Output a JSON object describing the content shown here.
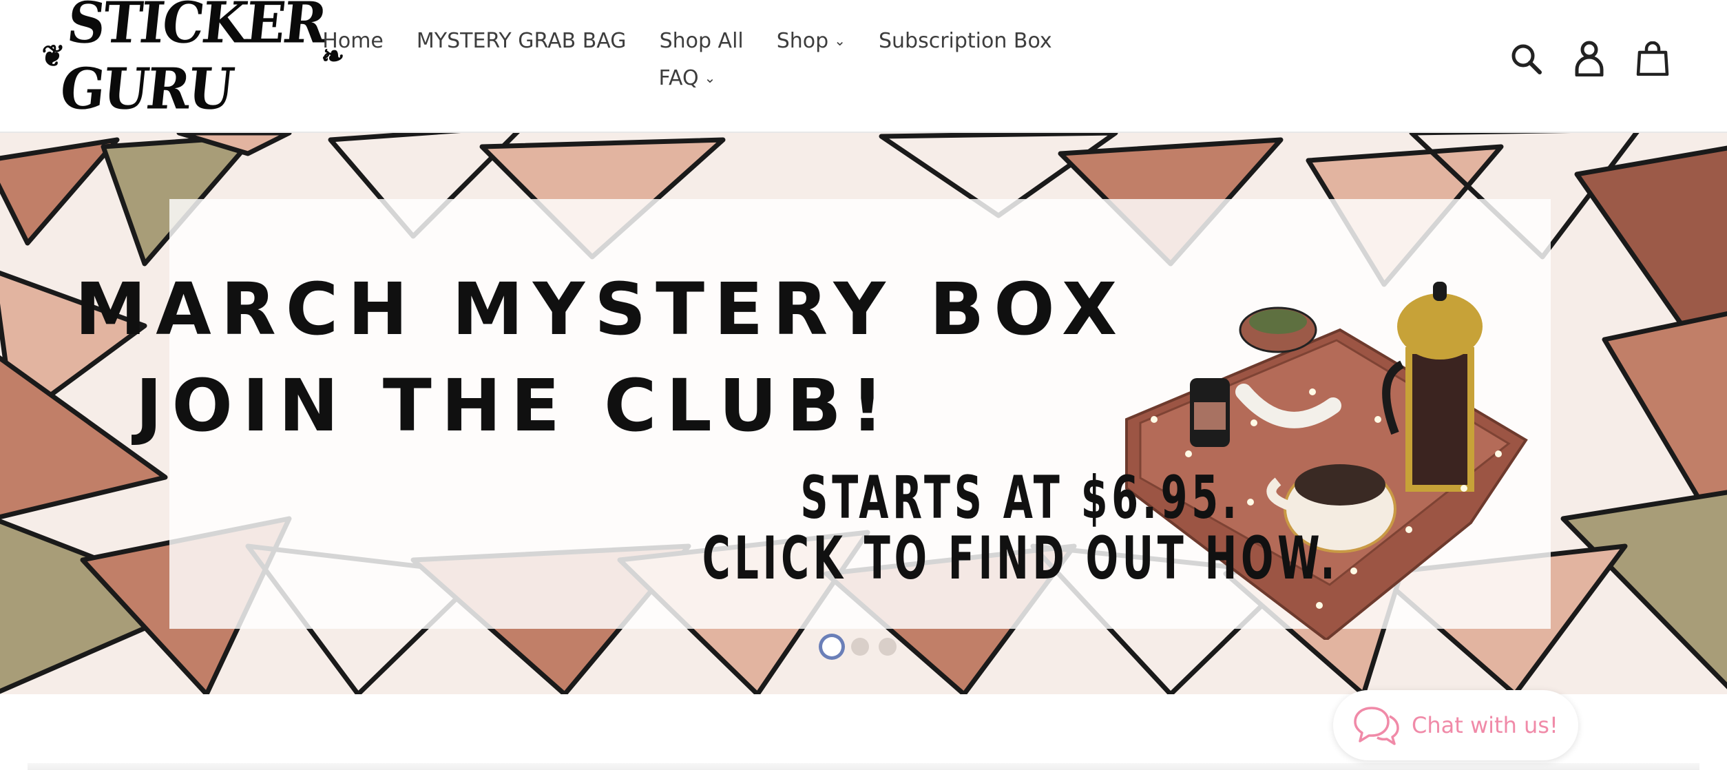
{
  "logo": {
    "text": "STICKER GURU"
  },
  "nav": {
    "row1": [
      {
        "label": "Home",
        "has_dropdown": false
      },
      {
        "label": "MYSTERY GRAB BAG",
        "has_dropdown": false
      },
      {
        "label": "Shop All",
        "has_dropdown": false
      },
      {
        "label": "Shop",
        "has_dropdown": true
      },
      {
        "label": "Subscription Box",
        "has_dropdown": false
      }
    ],
    "row2": [
      {
        "label": "FAQ",
        "has_dropdown": true
      }
    ]
  },
  "header_icons": [
    "search-icon",
    "account-icon",
    "cart-icon"
  ],
  "hero": {
    "line1": "MARCH MYSTERY BOX",
    "line2": "JOIN THE CLUB!",
    "line3": "STARTS AT $6.95.",
    "line4": "CLICK TO FIND OUT HOW.",
    "slides_total": 3,
    "active_slide": 1
  },
  "chat": {
    "label": "Chat with us!"
  },
  "colors": {
    "hero_bg": "#f6ede8",
    "triangle_terracotta": "#c17f68",
    "triangle_peach": "#e2b4a0",
    "triangle_olive": "#a89d78",
    "triangle_rust": "#9c5a48",
    "chat_pink": "#f08aa8",
    "dot_active_ring": "#6a7fb8"
  }
}
